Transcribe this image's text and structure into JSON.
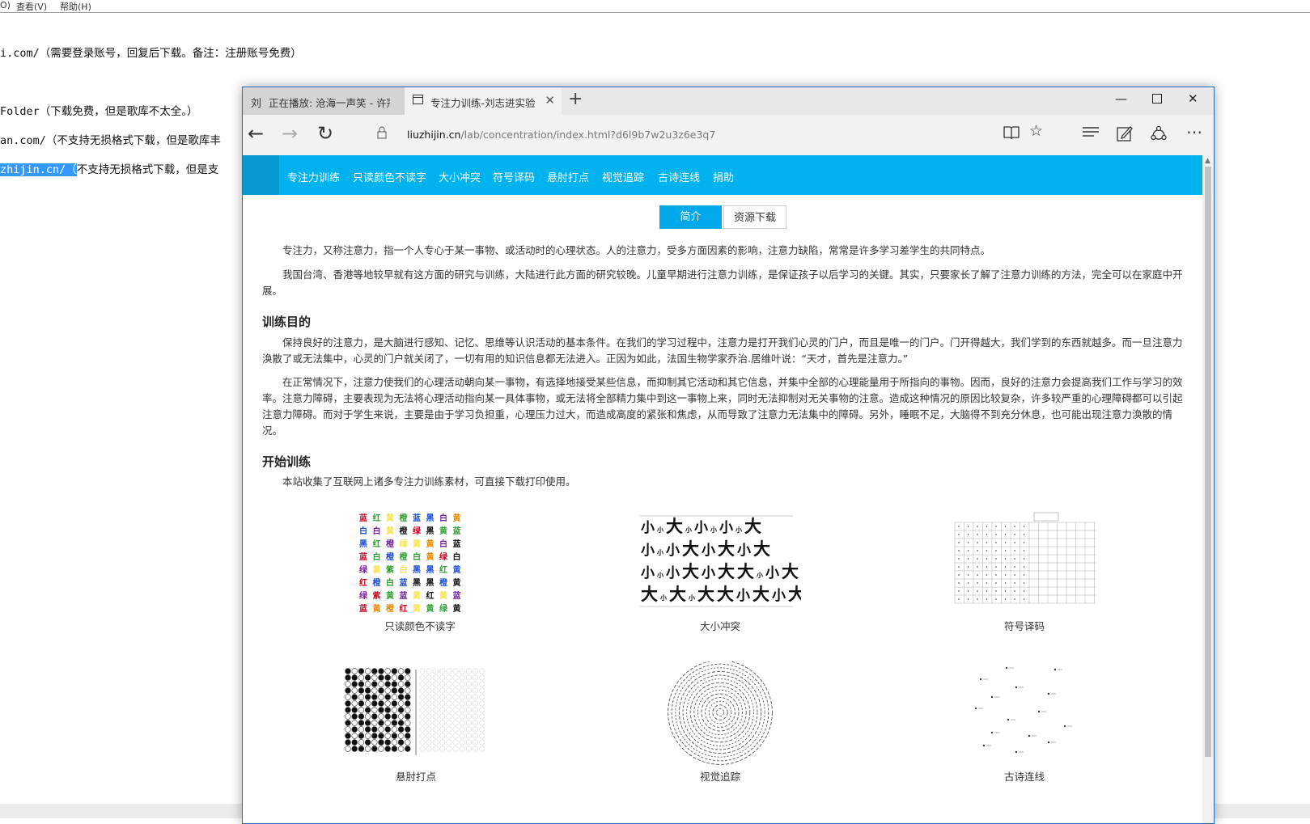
{
  "notepad": {
    "menu": [
      "O)",
      "查看(V)",
      "帮助(H)"
    ],
    "lines": [
      "i.com/（需要登录账号，回复后下载。备注：注册账号免费）",
      "Folder（下载免费，但是歌库不太全。）",
      "an.com/（不支持无损格式下载，但是歌库丰",
      "zhijin.cn/（",
      "不支持无损格式下载，但是支"
    ]
  },
  "browser": {
    "tabs": [
      {
        "icon": "刘",
        "label": "正在播放: 沧海一声笑 - 许冠"
      },
      {
        "icon": "page-icon",
        "label": "专注力训练-刘志进实验室"
      }
    ],
    "url_host": "liuzhijin.cn",
    "url_path": "/lab/concentration/index.html?d6l9b7w2u3z6e3q7"
  },
  "site": {
    "nav": [
      "专注力训练",
      "只读颜色不读字",
      "大小冲突",
      "符号译码",
      "悬肘打点",
      "视觉追踪",
      "古诗连线",
      "捐助"
    ],
    "buttons": {
      "intro": "简介",
      "download": "资源下载"
    },
    "intro_p1": "专注力，又称注意力，指一个人专心于某一事物、或活动时的心理状态。人的注意力，受多方面因素的影响，注意力缺陷，常常是许多学习差学生的共同特点。",
    "intro_p2": "我国台湾、香港等地较早就有这方面的研究与训练，大陆进行此方面的研究较晚。儿童早期进行注意力训练，是保证孩子以后学习的关键。其实，只要家长了解了注意力训练的方法，完全可以在家庭中开展。",
    "h_purpose": "训练目的",
    "purpose_p1": "保持良好的注意力，是大脑进行感知、记忆、思维等认识活动的基本条件。在我们的学习过程中，注意力是打开我们心灵的门户，而且是唯一的门户。门开得越大，我们学到的东西就越多。而一旦注意力涣散了或无法集中，心灵的门户就关闭了，一切有用的知识信息都无法进入。正因为如此，法国生物学家乔治.居维叶说：“天才，首先是注意力。”",
    "purpose_p2": "在正常情况下，注意力使我们的心理活动朝向某一事物，有选择地接受某些信息，而抑制其它活动和其它信息，并集中全部的心理能量用于所指向的事物。因而，良好的注意力会提高我们工作与学习的效率。注意力障碍，主要表现为无法将心理活动指向某一具体事物，或无法将全部精力集中到这一事物上来，同时无法抑制对无关事物的注意。造成这种情况的原因比较复杂，许多较严重的心理障碍都可以引起注意力障碍。而对于学生来说，主要是由于学习负担重，心理压力过大，而造成高度的紧张和焦虑，从而导致了注意力无法集中的障碍。另外，睡眠不足，大脑得不到充分休息，也可能出现注意力涣散的情况。",
    "h_start": "开始训练",
    "start_p": "本站收集了互联网上诸多专注力训练素材，可直接下载打印使用。",
    "cards": [
      "只读颜色不读字",
      "大小冲突",
      "符号译码",
      "悬肘打点",
      "视觉追踪",
      "古诗连线"
    ]
  },
  "stroop": {
    "rows": [
      [
        "蓝",
        "红",
        "黄",
        "橙",
        "蓝",
        "黑",
        "白",
        "黄"
      ],
      [
        "白",
        "白",
        "黄",
        "橙",
        "绿",
        "黑",
        "黄",
        "蓝"
      ],
      [
        "黑",
        "红",
        "橙",
        "绿",
        "黄",
        "黄",
        "白",
        "蓝"
      ],
      [
        "蓝",
        "白",
        "橙",
        "橙",
        "白",
        "黄",
        "绿",
        "白"
      ],
      [
        "绿",
        "黄",
        "紫",
        "白",
        "黑",
        "黑",
        "红",
        "黄"
      ],
      [
        "红",
        "橙",
        "白",
        "蓝",
        "黑",
        "黑",
        "橙",
        "黄"
      ],
      [
        "绿",
        "紫",
        "黄",
        "蓝",
        "黄",
        "红",
        "黄",
        "蓝"
      ],
      [
        "蓝",
        "黄",
        "橙",
        "红",
        "黄",
        "黄",
        "绿",
        "黄"
      ]
    ],
    "colors": [
      [
        "#d0021b",
        "#2e9e2e",
        "#f7e14b",
        "#2e9e2e",
        "#1a4fd6",
        "#1a4fd6",
        "#7b1fa2",
        "#e68a00"
      ],
      [
        "#1a4fd6",
        "#7b1fa2",
        "#f7e14b",
        "#111",
        "#d0021b",
        "#111",
        "#2e9e2e",
        "#2e9e2e"
      ],
      [
        "#1a4fd6",
        "#2e9e2e",
        "#7b1fa2",
        "#f7e14b",
        "#f7e14b",
        "#e68a00",
        "#7b1fa2",
        "#111"
      ],
      [
        "#d0021b",
        "#2e9e2e",
        "#1a4fd6",
        "#2e9e2e",
        "#2e9e2e",
        "#e68a00",
        "#d0021b",
        "#111"
      ],
      [
        "#7b1fa2",
        "#f7e14b",
        "#2e9e2e",
        "#f7e14b",
        "#1a4fd6",
        "#1a4fd6",
        "#2e9e2e",
        "#1a4fd6"
      ],
      [
        "#d0021b",
        "#1a4fd6",
        "#2e9e2e",
        "#1a4fd6",
        "#111",
        "#111",
        "#1a4fd6",
        "#111"
      ],
      [
        "#7b1fa2",
        "#d0021b",
        "#2e9e2e",
        "#7b1fa2",
        "#f7e14b",
        "#111",
        "#f7e14b",
        "#7b1fa2"
      ],
      [
        "#d0021b",
        "#e68a00",
        "#e68a00",
        "#d0021b",
        "#f7e14b",
        "#2e9e2e",
        "#2e9e2e",
        "#111"
      ]
    ]
  },
  "bigsmall": {
    "rows": [
      [
        "小",
        "小",
        "大",
        "小",
        "小",
        "小",
        "小",
        "小",
        "大"
      ],
      [
        "小",
        "小",
        "小",
        "大",
        "小",
        "大",
        "小",
        "大"
      ],
      [
        "小",
        "小",
        "小",
        "大",
        "小",
        "大",
        "大",
        "小",
        "小",
        "大"
      ],
      [
        "大",
        "小",
        "大",
        "小",
        "大",
        "大",
        "小",
        "大",
        "小",
        "大"
      ]
    ]
  }
}
